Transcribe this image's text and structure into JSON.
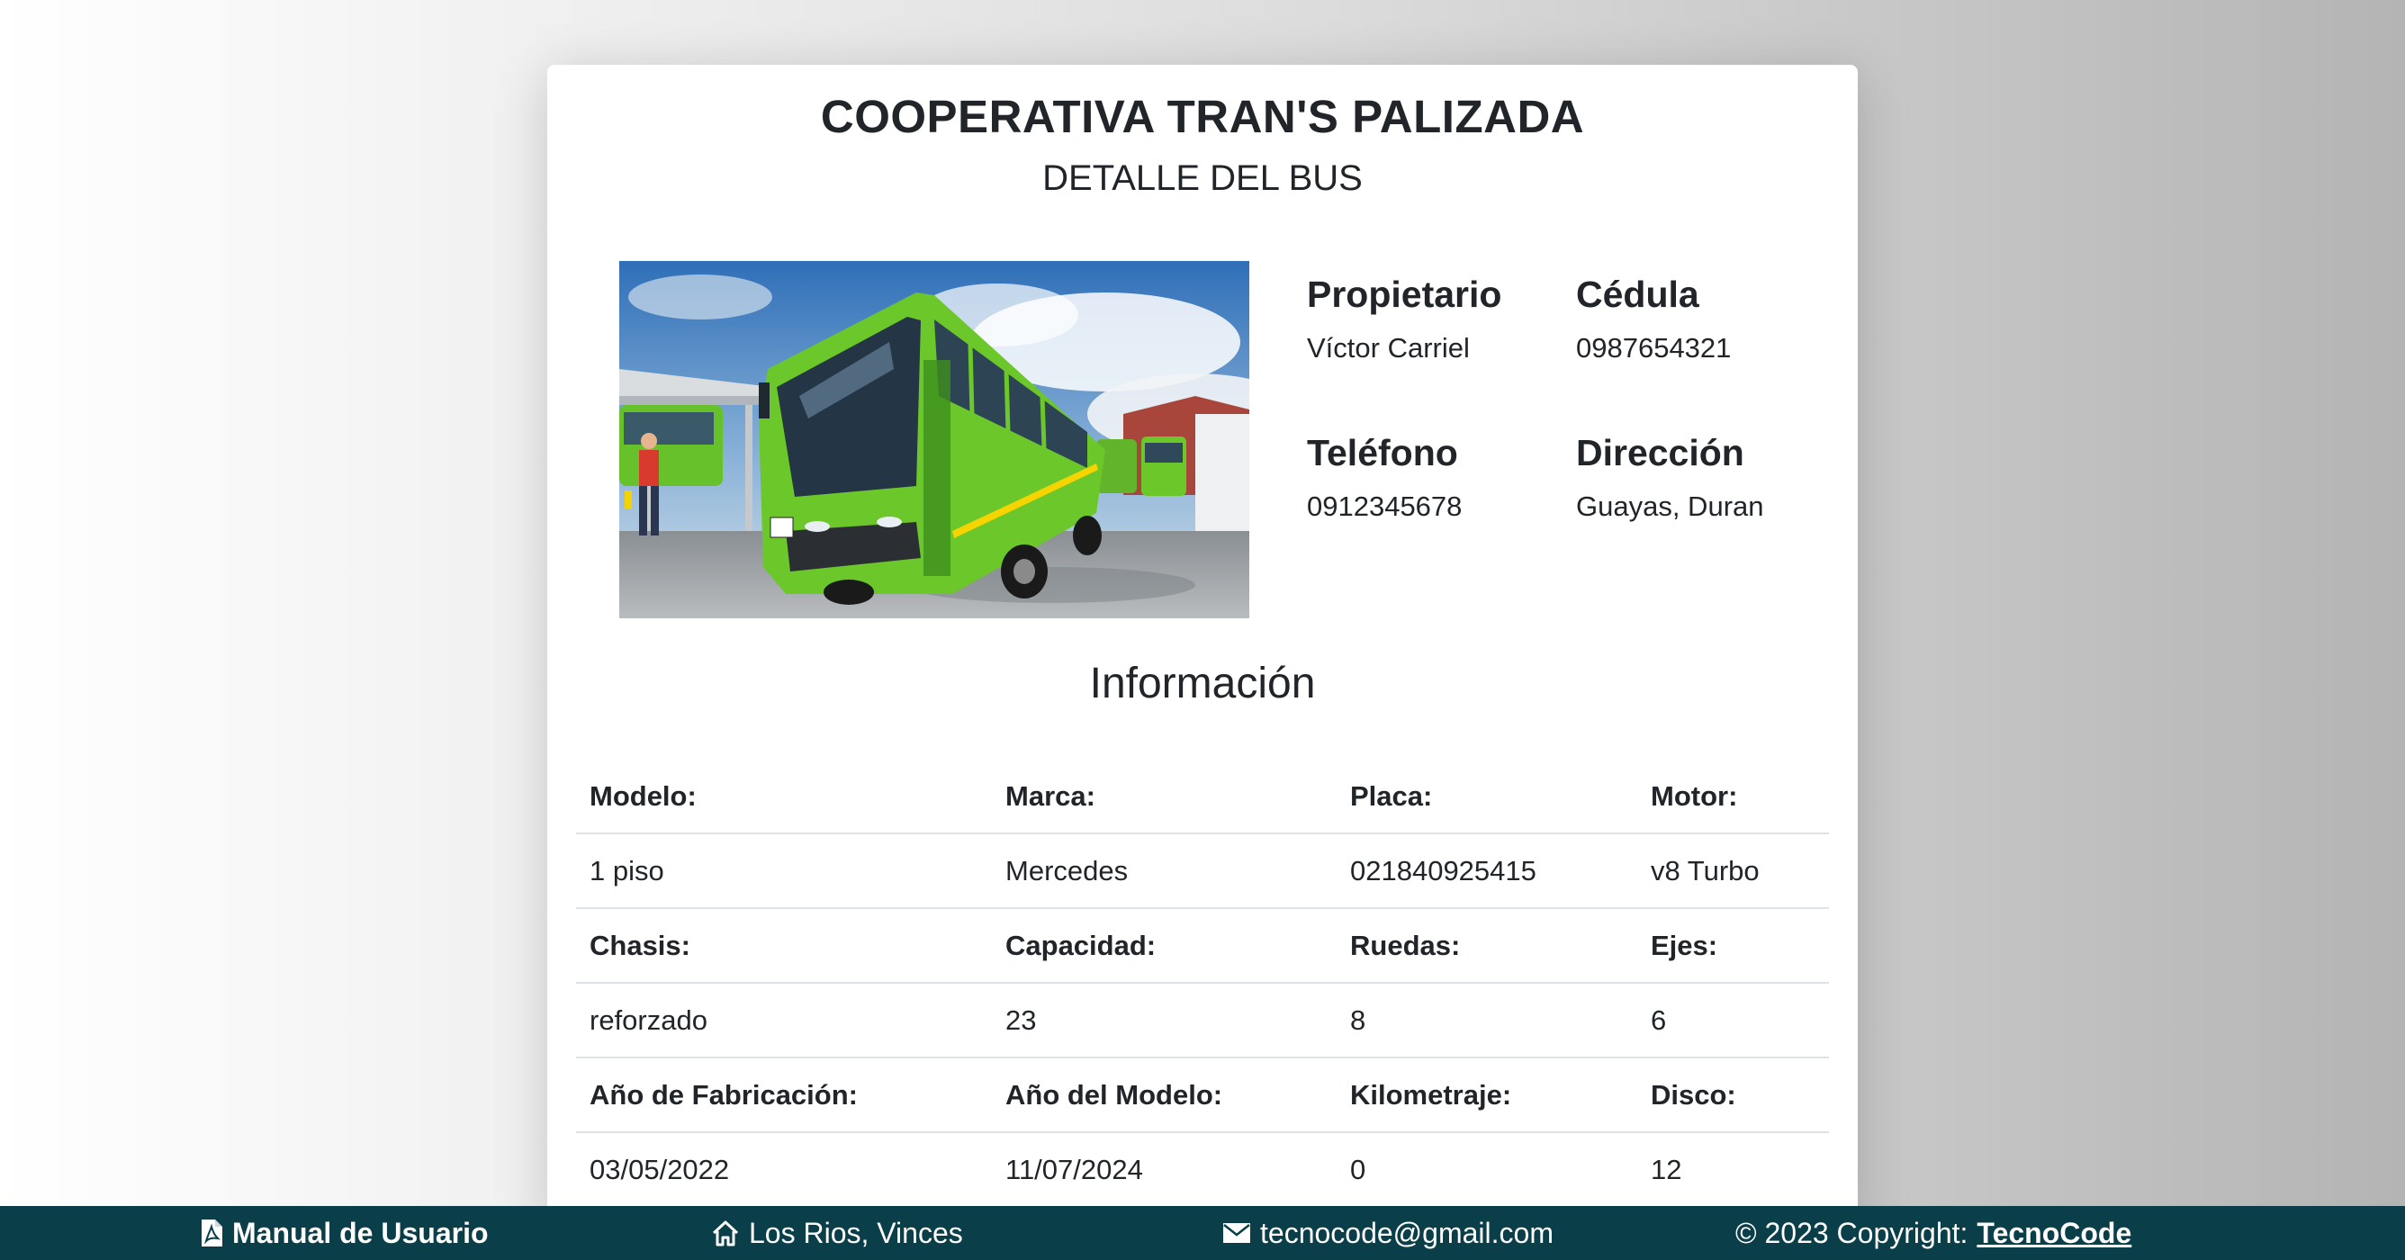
{
  "header": {
    "title": "COOPERATIVA TRAN'S PALIZADA",
    "subtitle": "DETALLE DEL BUS"
  },
  "owner": {
    "fields": [
      {
        "label": "Propietario",
        "value": "Víctor Carriel"
      },
      {
        "label": "Cédula",
        "value": "0987654321"
      },
      {
        "label": "Teléfono",
        "value": "0912345678"
      },
      {
        "label": "Dirección",
        "value": "Guayas, Duran"
      }
    ]
  },
  "info": {
    "heading": "Información",
    "rows": [
      {
        "labels": [
          "Modelo:",
          "Marca:",
          "Placa:",
          "Motor:"
        ],
        "values": [
          "1 piso",
          "Mercedes",
          "021840925415",
          "v8 Turbo"
        ]
      },
      {
        "labels": [
          "Chasis:",
          "Capacidad:",
          "Ruedas:",
          "Ejes:"
        ],
        "values": [
          "reforzado",
          "23",
          "8",
          "6"
        ]
      },
      {
        "labels": [
          "Año de Fabricación:",
          "Año del Modelo:",
          "Kilometraje:",
          "Disco:"
        ],
        "values": [
          "03/05/2022",
          "11/07/2024",
          "0",
          "12"
        ]
      }
    ]
  },
  "footer": {
    "manual_label": "Manual de Usuario",
    "location": "Los Rios, Vinces",
    "email": "tecnocode@gmail.com",
    "copyright": "© 2023 Copyright:",
    "brand": "TecnoCode"
  },
  "colors": {
    "footer_bg": "#0a3f4a",
    "bus_body": "#6cc72b",
    "text": "#212529"
  },
  "icons": {
    "manual": "pdf-file-icon",
    "location": "home-icon",
    "email": "envelope-icon"
  }
}
